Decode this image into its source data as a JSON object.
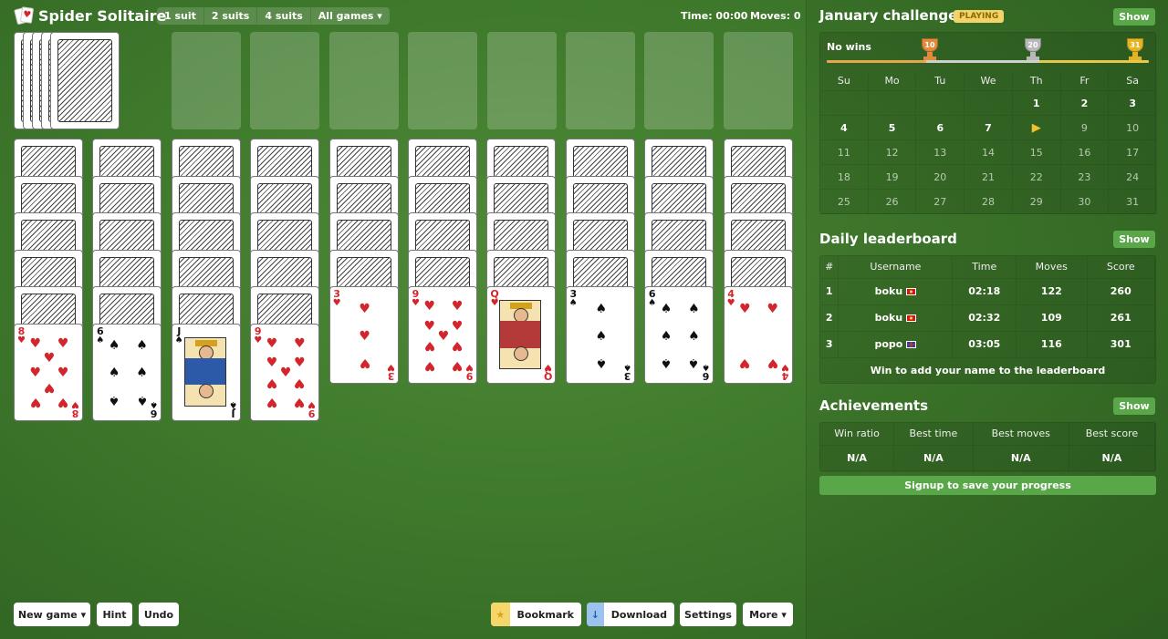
{
  "app": {
    "title": "Spider Solitaire"
  },
  "suit_options": [
    "1 suit",
    "2 suits",
    "4 suits",
    "All games ▾"
  ],
  "status": {
    "time_label": "Time: 00:00",
    "moves_label": "Moves: 0"
  },
  "toolbar": {
    "new_game": "New game ▾",
    "hint": "Hint",
    "undo": "Undo",
    "bookmark": "Bookmark",
    "download": "Download",
    "settings": "Settings",
    "more": "More ▾"
  },
  "board": {
    "stock_piles": 5,
    "foundation_slots": 8,
    "columns": [
      {
        "hidden": 5,
        "face_up": [
          {
            "rank": "8",
            "suit": "♥",
            "color": "red"
          }
        ]
      },
      {
        "hidden": 5,
        "face_up": [
          {
            "rank": "6",
            "suit": "♠",
            "color": "black"
          }
        ]
      },
      {
        "hidden": 5,
        "face_up": [
          {
            "rank": "J",
            "suit": "♠",
            "color": "black"
          }
        ]
      },
      {
        "hidden": 5,
        "face_up": [
          {
            "rank": "9",
            "suit": "♥",
            "color": "red"
          }
        ]
      },
      {
        "hidden": 4,
        "face_up": [
          {
            "rank": "3",
            "suit": "♥",
            "color": "red"
          }
        ]
      },
      {
        "hidden": 4,
        "face_up": [
          {
            "rank": "9",
            "suit": "♥",
            "color": "red"
          }
        ]
      },
      {
        "hidden": 4,
        "face_up": [
          {
            "rank": "Q",
            "suit": "♥",
            "color": "red"
          }
        ]
      },
      {
        "hidden": 4,
        "face_up": [
          {
            "rank": "3",
            "suit": "♠",
            "color": "black"
          }
        ]
      },
      {
        "hidden": 4,
        "face_up": [
          {
            "rank": "6",
            "suit": "♠",
            "color": "black"
          }
        ]
      },
      {
        "hidden": 4,
        "face_up": [
          {
            "rank": "4",
            "suit": "♥",
            "color": "red"
          }
        ]
      }
    ]
  },
  "challenge": {
    "title": "January challenge",
    "badge": "PLAYING",
    "show": "Show",
    "progress_label": "No wins",
    "trophies": [
      {
        "value": "10",
        "color": "#e08a3c"
      },
      {
        "value": "20",
        "color": "#b9b9b9"
      },
      {
        "value": "31",
        "color": "#e6b422"
      }
    ],
    "weekdays": [
      "Su",
      "Mo",
      "Tu",
      "We",
      "Th",
      "Fr",
      "Sa"
    ],
    "days": [
      "",
      "",
      "",
      "",
      "1",
      "2",
      "3",
      "4",
      "5",
      "6",
      "7",
      "8",
      "9",
      "10",
      "11",
      "12",
      "13",
      "14",
      "15",
      "16",
      "17",
      "18",
      "19",
      "20",
      "21",
      "22",
      "23",
      "24",
      "25",
      "26",
      "27",
      "28",
      "29",
      "30",
      "31"
    ],
    "today": "8"
  },
  "leaderboard": {
    "title": "Daily leaderboard",
    "show": "Show",
    "columns": [
      "#",
      "Username",
      "Time",
      "Moves",
      "Score"
    ],
    "rows": [
      {
        "rank": "1",
        "user": "boku",
        "flag": "mk",
        "time": "02:18",
        "moves": "122",
        "score": "260"
      },
      {
        "rank": "2",
        "user": "boku",
        "flag": "mk",
        "time": "02:32",
        "moves": "109",
        "score": "261"
      },
      {
        "rank": "3",
        "user": "popo",
        "flag": "gb",
        "time": "03:05",
        "moves": "116",
        "score": "301"
      }
    ],
    "footer": "Win to add your name to the leaderboard"
  },
  "achievements": {
    "title": "Achievements",
    "show": "Show",
    "columns": [
      "Win ratio",
      "Best time",
      "Best moves",
      "Best score"
    ],
    "values": [
      "N/A",
      "N/A",
      "N/A",
      "N/A"
    ],
    "signup": "Signup to save your progress"
  },
  "colors": {
    "felt": "#3f7a2c",
    "accent": "#5aa74a",
    "red_suit": "#d3262c",
    "badge": "#f4d46a"
  }
}
